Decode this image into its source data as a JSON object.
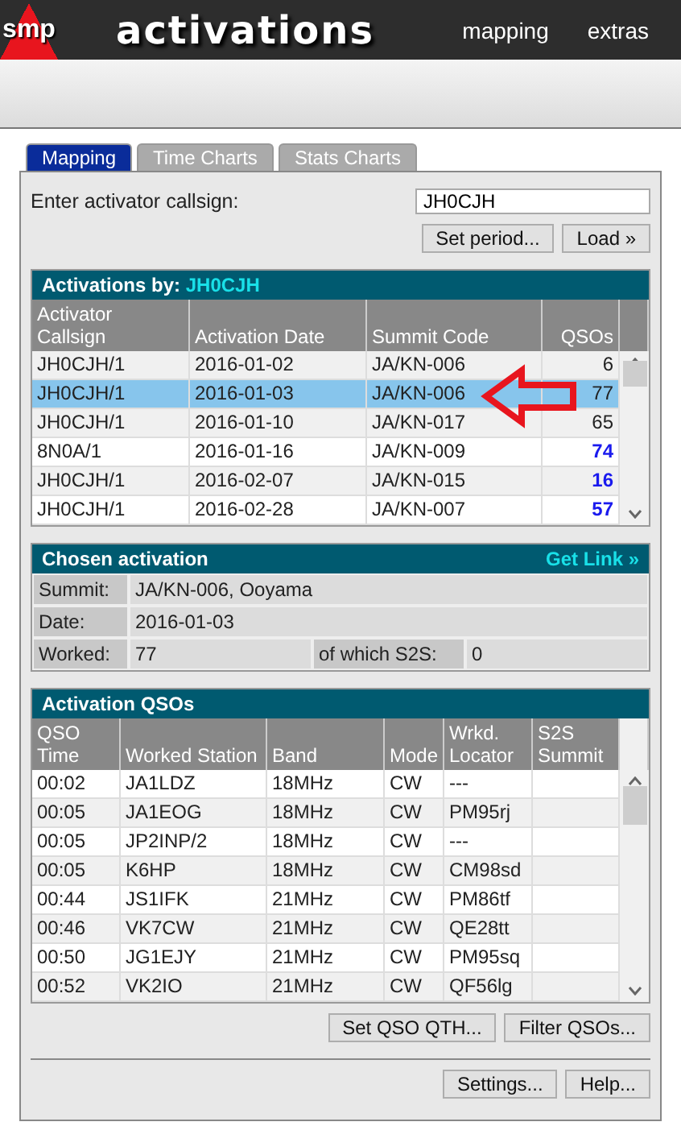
{
  "header": {
    "logo": "smp",
    "title": "activations",
    "nav": [
      "mapping",
      "extras"
    ]
  },
  "tabs": [
    {
      "label": "Mapping",
      "selected": true
    },
    {
      "label": "Time Charts",
      "selected": false
    },
    {
      "label": "Stats Charts",
      "selected": false
    }
  ],
  "callsign_field": {
    "label": "Enter activator callsign:",
    "value": "JH0CJH"
  },
  "search_buttons": [
    "Set period...",
    "Load »"
  ],
  "activations": {
    "title": "Activations by:",
    "callsign": "JH0CJH",
    "columns": [
      "Activator Callsign",
      "Activation Date",
      "Summit Code",
      "QSOs"
    ],
    "rows": [
      {
        "cells": [
          "JH0CJH/1",
          "2016-01-02",
          "JA/KN-006",
          "6"
        ],
        "emphasized": false,
        "selected": false
      },
      {
        "cells": [
          "JH0CJH/1",
          "2016-01-03",
          "JA/KN-006",
          "77"
        ],
        "emphasized": false,
        "selected": true
      },
      {
        "cells": [
          "JH0CJH/1",
          "2016-01-10",
          "JA/KN-017",
          "65"
        ],
        "emphasized": false,
        "selected": false
      },
      {
        "cells": [
          "8N0A/1",
          "2016-01-16",
          "JA/KN-009",
          "74"
        ],
        "emphasized": true,
        "selected": false
      },
      {
        "cells": [
          "JH0CJH/1",
          "2016-02-07",
          "JA/KN-015",
          "16"
        ],
        "emphasized": true,
        "selected": false
      },
      {
        "cells": [
          "JH0CJH/1",
          "2016-02-28",
          "JA/KN-007",
          "57"
        ],
        "emphasized": true,
        "selected": false
      }
    ]
  },
  "chosen": {
    "title": "Chosen activation",
    "link": "Get Link »",
    "summit_label": "Summit:",
    "summit": "JA/KN-006, Ooyama",
    "date_label": "Date:",
    "date": "2016-01-03",
    "worked_label": "Worked:",
    "worked": "77",
    "s2s_label": "of which S2S:",
    "s2s": "0"
  },
  "qsos": {
    "title": "Activation QSOs",
    "columns": [
      "QSO Time",
      "Worked Station",
      "Band",
      "Mode",
      "Wrkd. Locator",
      "S2S Summit"
    ],
    "rows": [
      [
        "00:02",
        "JA1LDZ",
        "18MHz",
        "CW",
        "---"
      ],
      [
        "00:05",
        "JA1EOG",
        "18MHz",
        "CW",
        "PM95rj"
      ],
      [
        "00:05",
        "JP2INP/2",
        "18MHz",
        "CW",
        "---"
      ],
      [
        "00:05",
        "K6HP",
        "18MHz",
        "CW",
        "CM98sd"
      ],
      [
        "00:44",
        "JS1IFK",
        "21MHz",
        "CW",
        "PM86tf"
      ],
      [
        "00:46",
        "VK7CW",
        "21MHz",
        "CW",
        "QE28tt"
      ],
      [
        "00:50",
        "JG1EJY",
        "21MHz",
        "CW",
        "PM95sq"
      ],
      [
        "00:52",
        "VK2IO",
        "21MHz",
        "CW",
        "QF56lg"
      ]
    ]
  },
  "qso_buttons": [
    "Set QSO QTH...",
    "Filter QSOs..."
  ],
  "footer_buttons": [
    "Settings...",
    "Help..."
  ]
}
